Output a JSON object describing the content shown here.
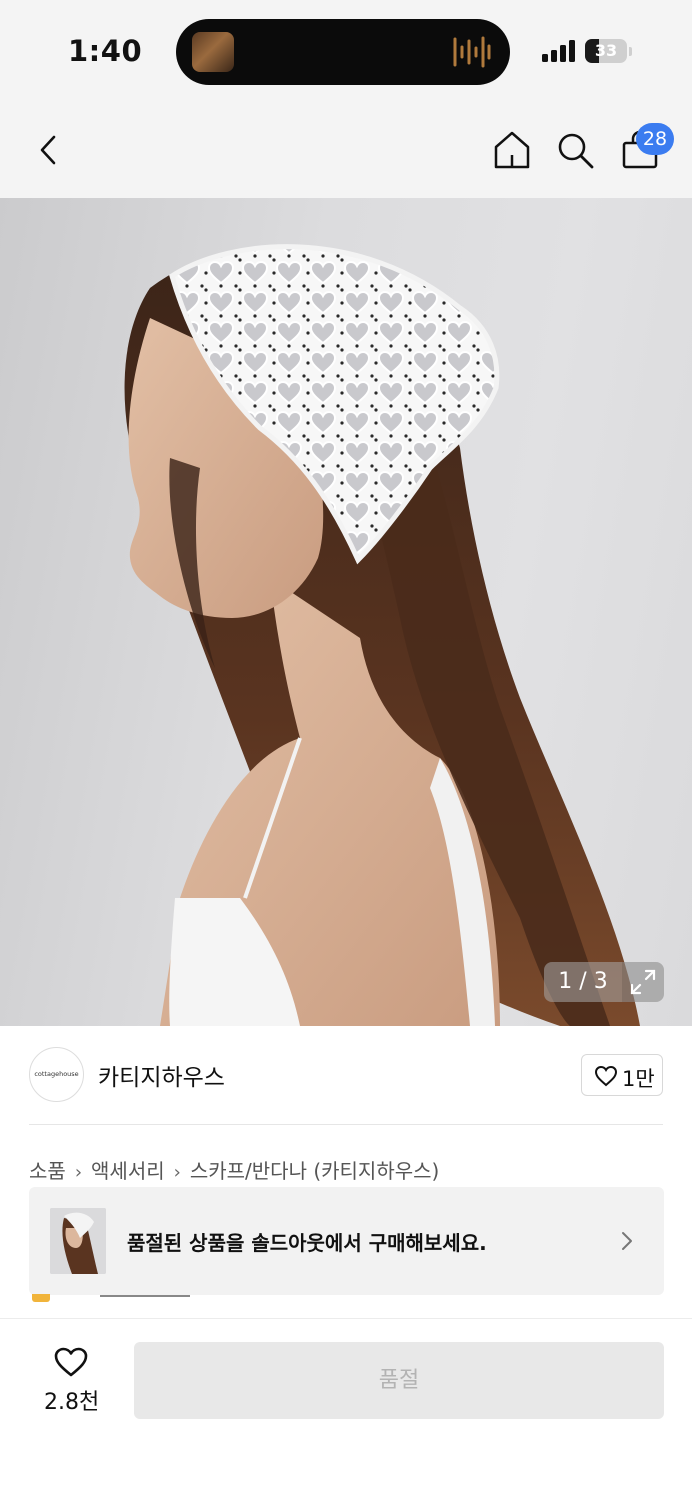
{
  "status_bar": {
    "time": "1:40",
    "battery_level": "33",
    "battery_fraction": 0.33
  },
  "header": {
    "cart_count": "28",
    "icons": [
      "back-icon",
      "home-icon",
      "search-icon",
      "shopping-bag-icon"
    ]
  },
  "gallery": {
    "page_indicator": "1 / 3"
  },
  "brand": {
    "logo_text": "cottagehouse",
    "name": "카티지하우스",
    "favorite_count": "1만"
  },
  "breadcrumb": [
    "소품",
    "액세서리",
    "스카프/반다나 (카티지하우스)"
  ],
  "soldout_banner": {
    "message": "품절된 상품을 솔드아웃에서 구매해보세요."
  },
  "bottom_bar": {
    "like_count": "2.8천",
    "buy_button_label": "품절"
  },
  "colors": {
    "accent": "#3b7cf0",
    "header_bg": "#f4f4f4",
    "disabled_button_bg": "#e8e8e8",
    "disabled_button_text": "#b3b3b3"
  }
}
